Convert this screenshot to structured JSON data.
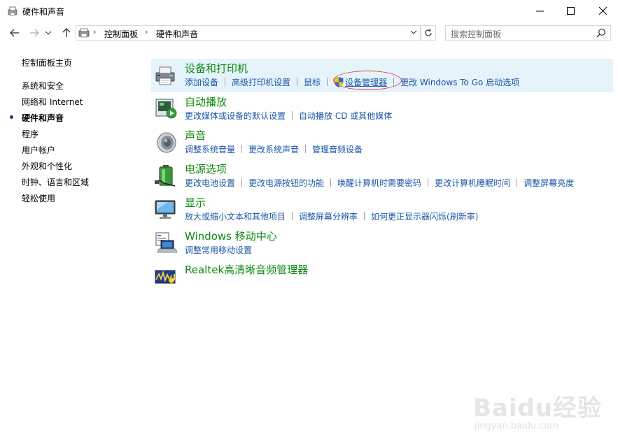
{
  "window": {
    "title": "硬件和声音",
    "controls": {
      "minimize": "—",
      "maximize": "☐",
      "close": "✕"
    }
  },
  "address": {
    "crumbs": [
      "控制面板",
      "硬件和声音"
    ],
    "separator": "›",
    "search_placeholder": "搜索控制面板"
  },
  "leftnav": {
    "items": [
      {
        "label": "控制面板主页",
        "current": false
      },
      {
        "label": "系统和安全",
        "current": false
      },
      {
        "label": "网络和 Internet",
        "current": false
      },
      {
        "label": "硬件和声音",
        "current": true
      },
      {
        "label": "程序",
        "current": false
      },
      {
        "label": "用户帐户",
        "current": false
      },
      {
        "label": "外观和个性化",
        "current": false
      },
      {
        "label": "时钟、语言和区域",
        "current": false
      },
      {
        "label": "轻松使用",
        "current": false
      }
    ]
  },
  "categories": [
    {
      "title": "设备和打印机",
      "icon": "printer-icon",
      "links": [
        "添加设备",
        "高级打印机设置",
        "鼠标",
        "设备管理器",
        "更改 Windows To Go 启动选项"
      ]
    },
    {
      "title": "自动播放",
      "icon": "autoplay-icon",
      "links": [
        "更改媒体或设备的默认设置",
        "自动播放 CD 或其他媒体"
      ]
    },
    {
      "title": "声音",
      "icon": "speaker-icon",
      "links": [
        "调整系统音量",
        "更改系统声音",
        "管理音频设备"
      ]
    },
    {
      "title": "电源选项",
      "icon": "battery-icon",
      "links": [
        "更改电池设置",
        "更改电源按钮的功能",
        "唤醒计算机时需要密码",
        "更改计算机睡眠时间",
        "调整屏幕亮度"
      ]
    },
    {
      "title": "显示",
      "icon": "monitor-icon",
      "links": [
        "放大或缩小文本和其他项目",
        "调整屏幕分辨率",
        "如何更正显示器闪烁(刷新率)"
      ]
    },
    {
      "title": "Windows 移动中心",
      "icon": "mobility-center-icon",
      "links": [
        "调整常用移动设置"
      ]
    },
    {
      "title": "Realtek高清晰音频管理器",
      "icon": "realtek-audio-icon",
      "links": []
    }
  ],
  "colors": {
    "category_title": "#108a10",
    "link": "#1c56a8",
    "highlight_bg": "#e5f3fb",
    "annotation_circle": "#e64b4b"
  },
  "watermark": {
    "logo": "Baidu经验",
    "site": "jingyan.baidu.com"
  }
}
